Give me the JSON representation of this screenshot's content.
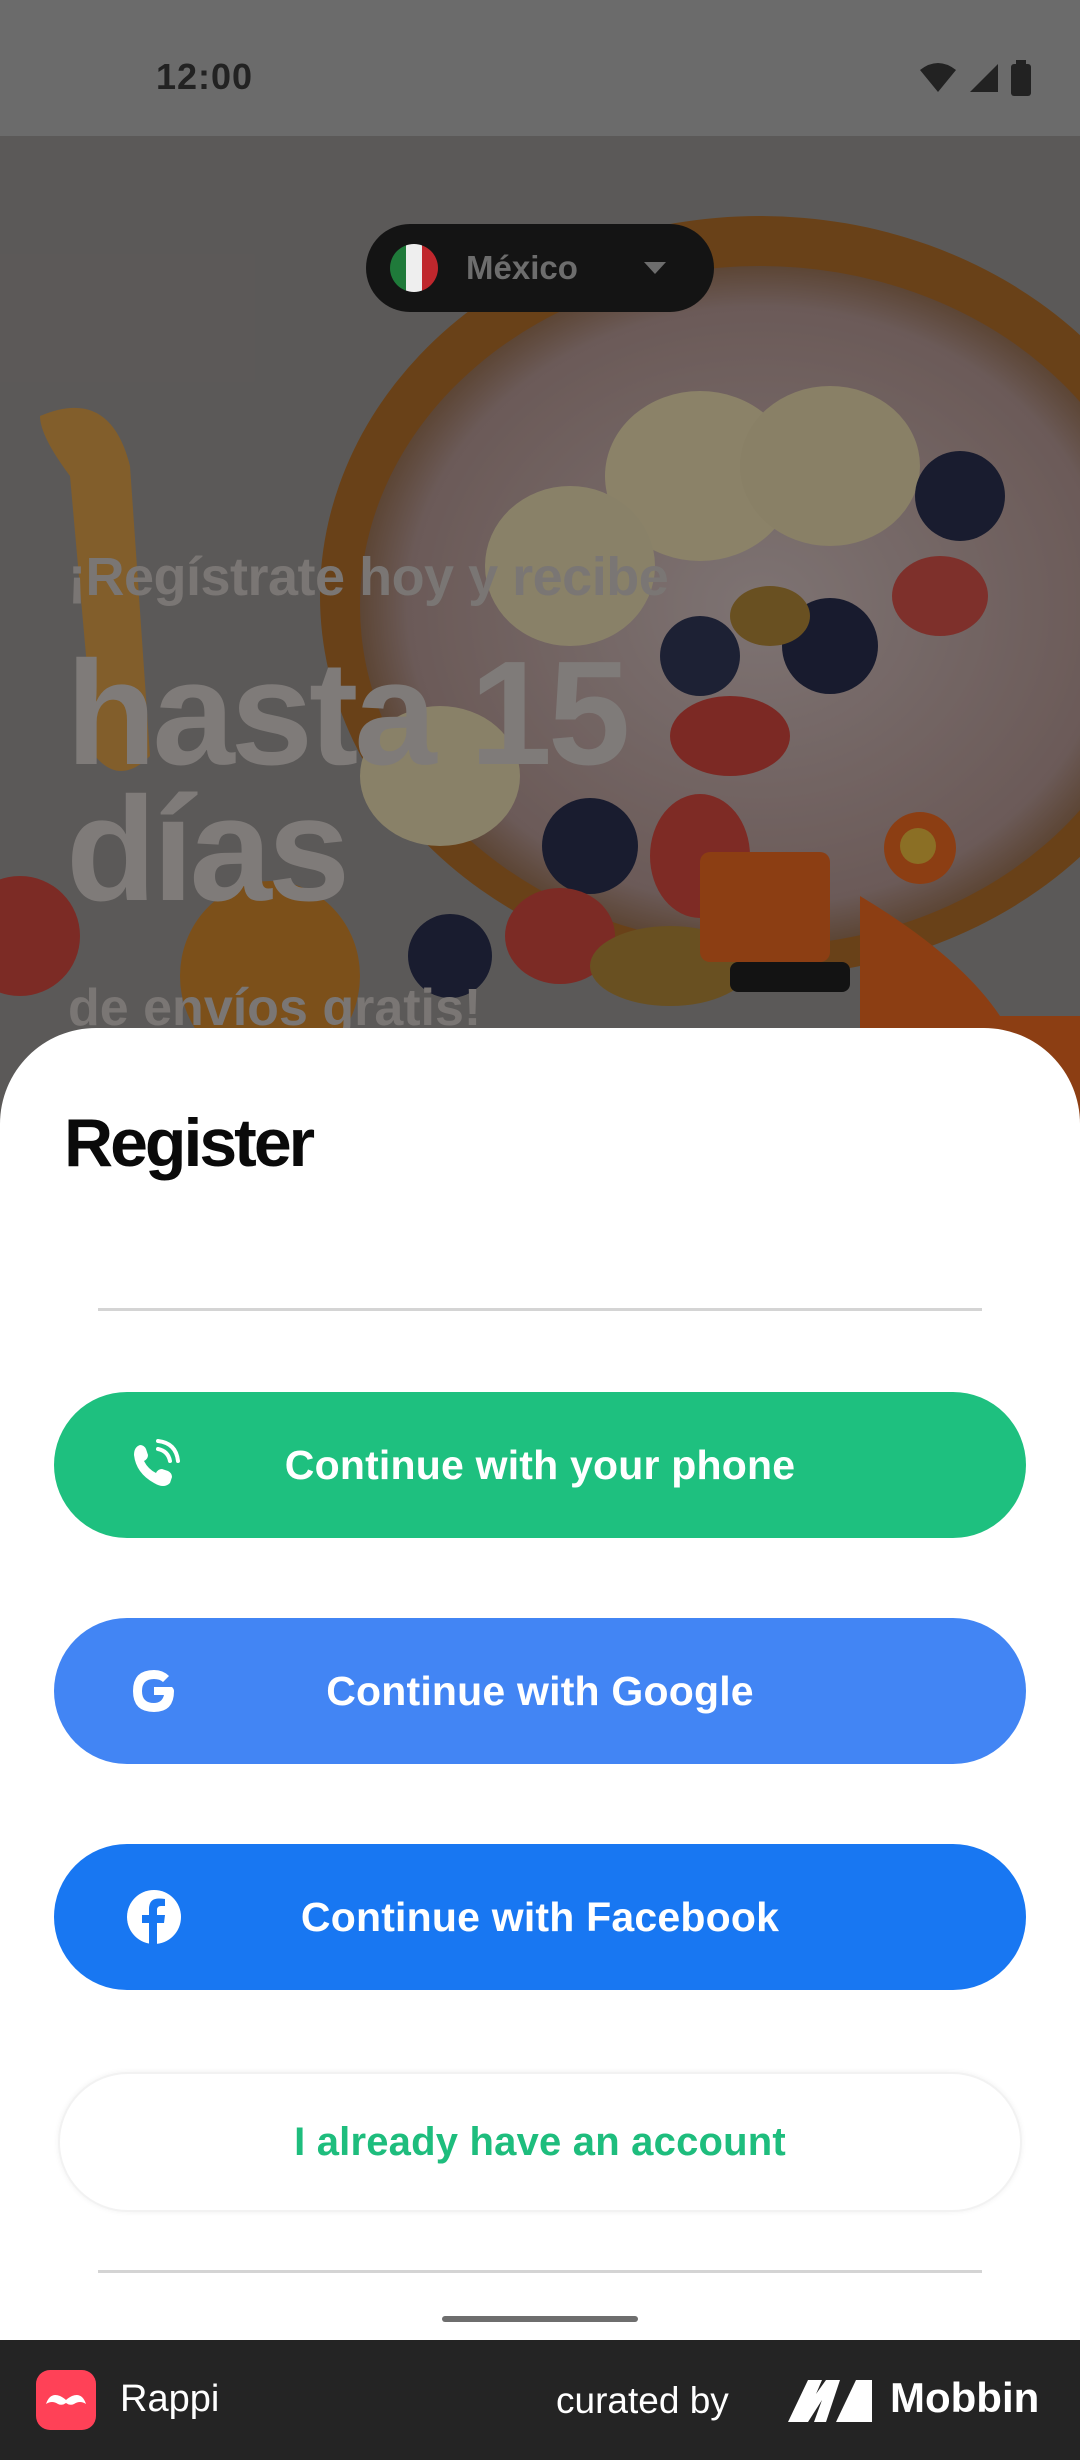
{
  "status_bar": {
    "time": "12:00",
    "icons": [
      "wifi-icon",
      "signal-icon",
      "battery-icon"
    ]
  },
  "hero": {
    "country_selector": {
      "label": "México",
      "flag_icon": "mexico-flag-icon"
    },
    "promo": {
      "line1": "¡Regístrate hoy y recibe",
      "line2": "hasta 15",
      "line3": "días",
      "line4": "de envíos gratis!"
    }
  },
  "sheet": {
    "title": "Register",
    "buttons": [
      {
        "label": "Continue with your phone",
        "icon": "phone-icon",
        "color": "#1ec07f"
      },
      {
        "label": "Continue with Google",
        "icon": "google-icon",
        "color": "#4285f4"
      },
      {
        "label": "Continue with Facebook",
        "icon": "facebook-icon",
        "color": "#1877f2"
      }
    ],
    "secondary_button": {
      "label": "I already have an account",
      "color": "#1ebd7d"
    }
  },
  "footer": {
    "app_name": "Rappi",
    "curated_label": "curated by",
    "brand_name": "Mobbin",
    "app_color": "#ff4157"
  }
}
